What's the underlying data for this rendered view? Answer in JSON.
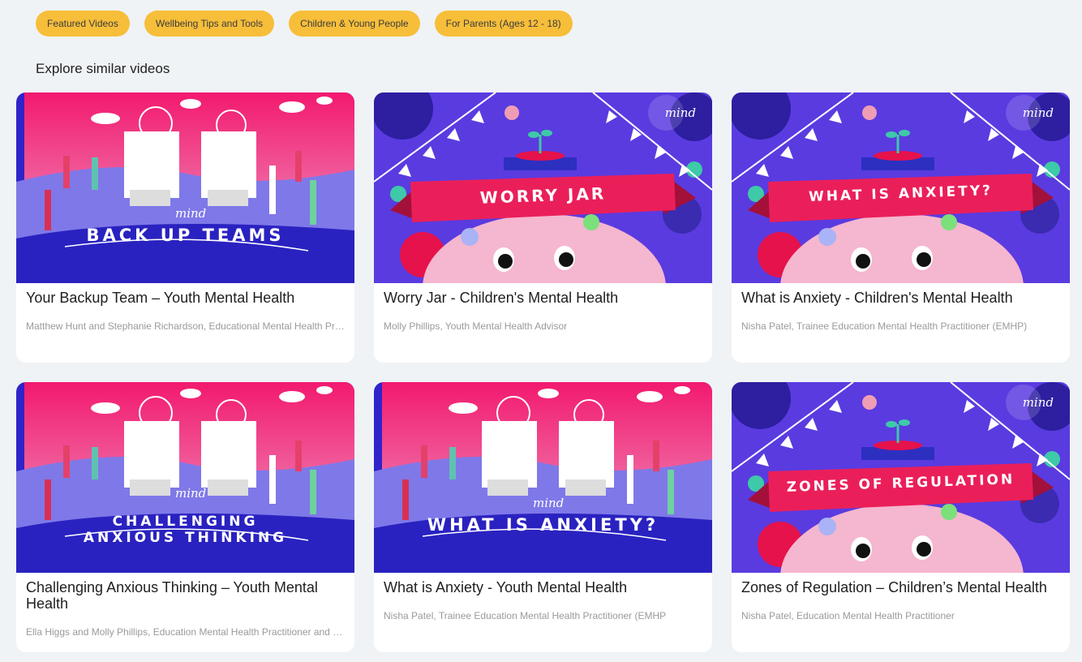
{
  "tags": [
    "Featured Videos",
    "Wellbeing Tips and Tools",
    "Children & Young People",
    "For Parents (Ages 12 - 18)"
  ],
  "section_title": "Explore similar videos",
  "videos": [
    {
      "style": "heads",
      "thumb_lines": [
        "BACK UP TEAMS"
      ],
      "logo": "mind",
      "title": "Your Backup Team – Youth Mental Health",
      "author": "Matthew Hunt and Stephanie Richardson, Educational Mental Health Practitioners"
    },
    {
      "style": "banner",
      "thumb_lines": [
        "WORRY JAR"
      ],
      "logo": "mind",
      "title": "Worry Jar - Children's Mental Health",
      "author": "Molly Phillips, Youth Mental Health Advisor"
    },
    {
      "style": "banner",
      "thumb_lines": [
        "WHAT IS ANXIETY?"
      ],
      "logo": "mind",
      "title": "What is Anxiety - Children's Mental Health",
      "author": "Nisha Patel, Trainee Education Mental Health Practitioner (EMHP)"
    },
    {
      "style": "heads",
      "thumb_lines": [
        "CHALLENGING",
        "ANXIOUS THINKING"
      ],
      "logo": "mind",
      "title": "Challenging Anxious Thinking – Youth Mental Health",
      "author": "Ella Higgs and Molly Phillips, Education Mental Health Practitioner and Mental Health Advisor"
    },
    {
      "style": "heads",
      "thumb_lines": [
        "WHAT IS ANXIETY?"
      ],
      "logo": "mind",
      "title": "What is Anxiety - Youth Mental Health",
      "author": "Nisha Patel, Trainee Education Mental Health Practitioner (EMHP"
    },
    {
      "style": "banner",
      "thumb_lines": [
        "ZONES OF REGULATION"
      ],
      "logo": "mind",
      "title": "Zones of Regulation – Children’s Mental Health",
      "author": "Nisha Patel, Education Mental Health Practitioner"
    }
  ],
  "colors": {
    "tag_bg": "#f7be3a",
    "page_bg": "#eff3f6",
    "banner_red": "#ea1f5a",
    "bg_purple": "#5a3be0"
  }
}
